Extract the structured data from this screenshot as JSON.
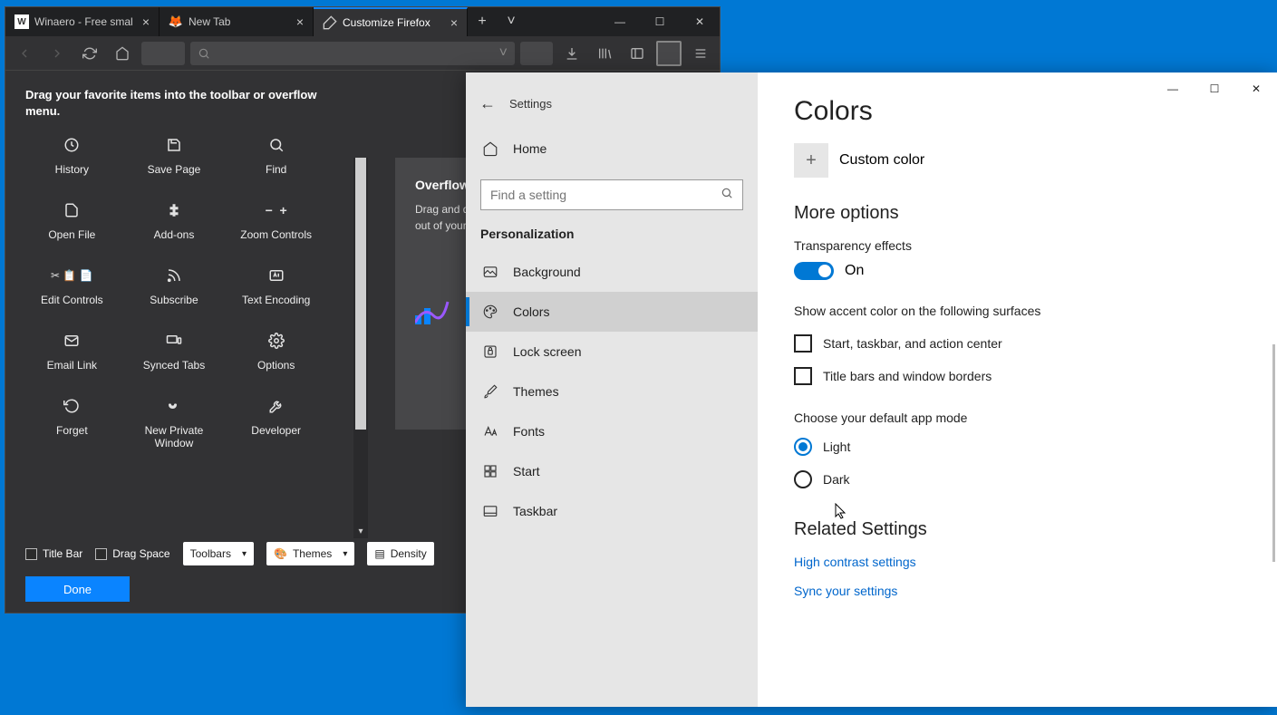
{
  "firefox": {
    "tabs": [
      {
        "label": "Winaero - Free smal"
      },
      {
        "label": "New Tab"
      },
      {
        "label": "Customize Firefox"
      }
    ],
    "instruction": "Drag your favorite items into the toolbar or overflow menu.",
    "items": [
      {
        "label": "History"
      },
      {
        "label": "Save Page"
      },
      {
        "label": "Find"
      },
      {
        "label": "Open File"
      },
      {
        "label": "Add-ons"
      },
      {
        "label": "Zoom Controls"
      },
      {
        "label": "Edit Controls"
      },
      {
        "label": "Subscribe"
      },
      {
        "label": "Text Encoding"
      },
      {
        "label": "Email Link"
      },
      {
        "label": "Synced Tabs"
      },
      {
        "label": "Options"
      },
      {
        "label": "Forget"
      },
      {
        "label": "New Private Window"
      },
      {
        "label": "Developer"
      }
    ],
    "overflow": {
      "title": "Overflow",
      "text": "Drag and drop items here to keep them within reach but out of your toolbar…"
    },
    "checkboxes": {
      "titlebar": "Title Bar",
      "dragspace": "Drag Space"
    },
    "selects": {
      "toolbars": "Toolbars",
      "themes": "Themes",
      "density": "Density"
    },
    "done": "Done"
  },
  "settings": {
    "title": "Settings",
    "home": "Home",
    "search_placeholder": "Find a setting",
    "category": "Personalization",
    "nav": [
      {
        "label": "Background"
      },
      {
        "label": "Colors"
      },
      {
        "label": "Lock screen"
      },
      {
        "label": "Themes"
      },
      {
        "label": "Fonts"
      },
      {
        "label": "Start"
      },
      {
        "label": "Taskbar"
      }
    ],
    "page": {
      "heading": "Colors",
      "custom_color": "Custom color",
      "more_options": "More options",
      "transparency_label": "Transparency effects",
      "transparency_value": "On",
      "accent_label": "Show accent color on the following surfaces",
      "chk1": "Start, taskbar, and action center",
      "chk2": "Title bars and window borders",
      "mode_label": "Choose your default app mode",
      "radio_light": "Light",
      "radio_dark": "Dark",
      "related": "Related Settings",
      "link1": "High contrast settings",
      "link2": "Sync your settings"
    }
  }
}
